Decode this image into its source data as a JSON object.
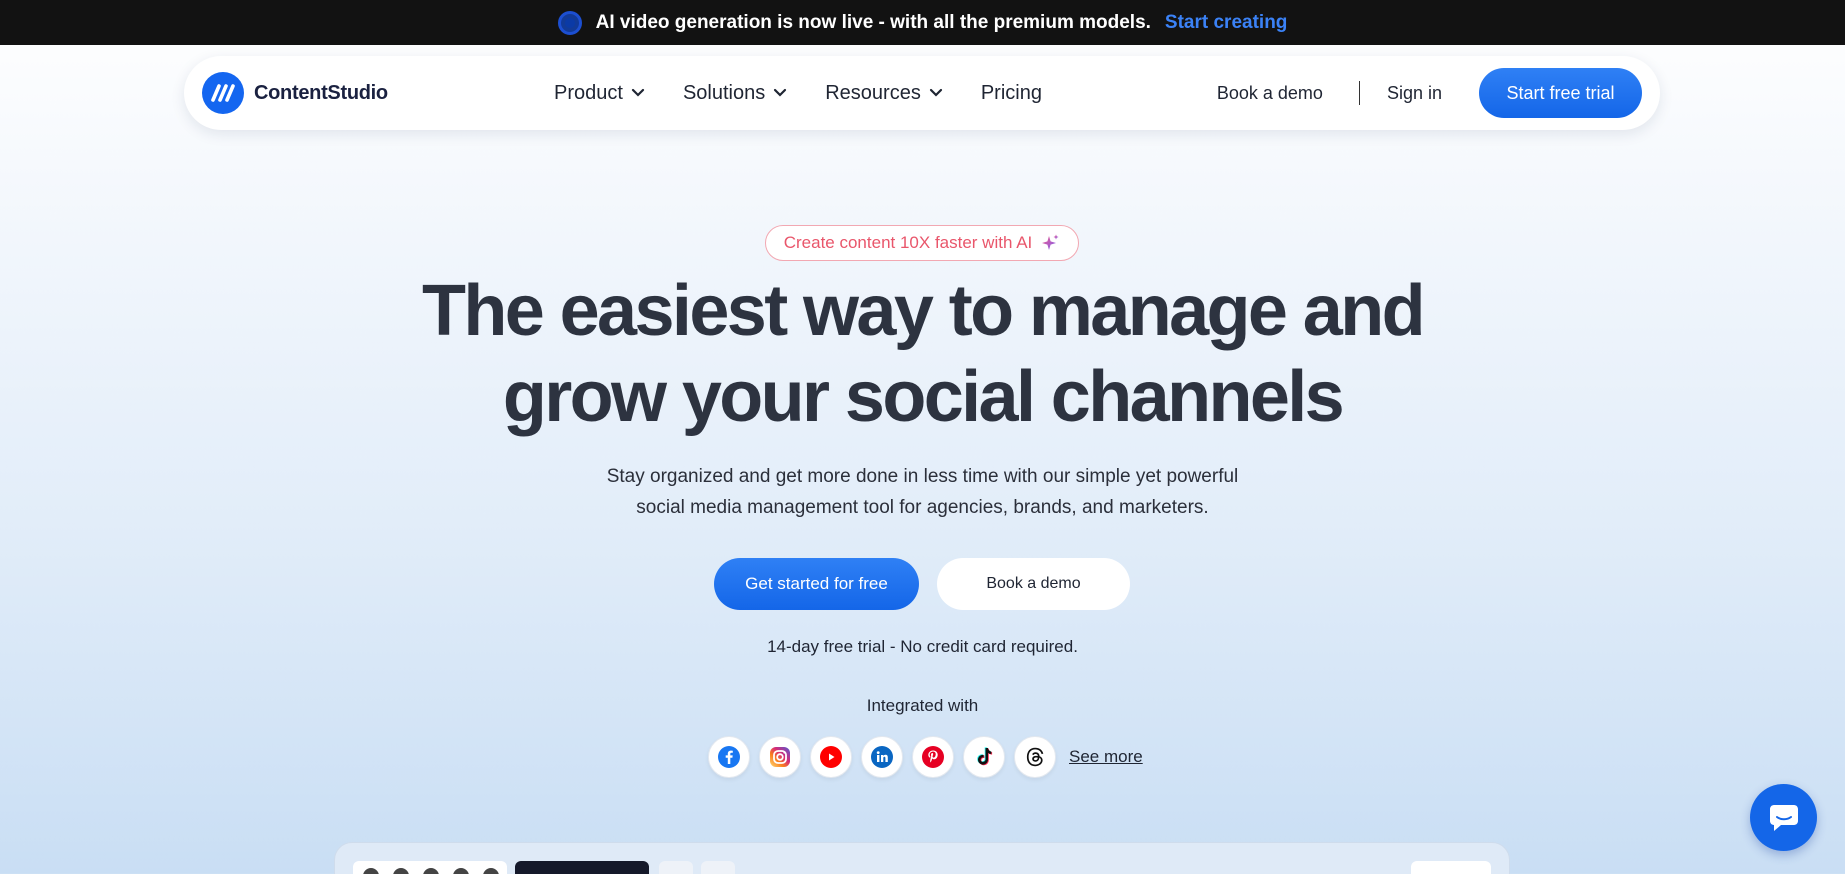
{
  "announcement": {
    "text": "AI video generation is now live - with all the premium models.",
    "cta": "Start creating"
  },
  "nav": {
    "brand": "ContentStudio",
    "links": [
      {
        "label": "Product",
        "dropdown": true
      },
      {
        "label": "Solutions",
        "dropdown": true
      },
      {
        "label": "Resources",
        "dropdown": true
      },
      {
        "label": "Pricing",
        "dropdown": false
      }
    ],
    "book_demo": "Book a demo",
    "sign_in": "Sign in",
    "start_trial": "Start free trial"
  },
  "hero": {
    "pill": "Create content 10X faster with AI",
    "title_line1": "The easiest way to manage and",
    "title_line2": "grow your social channels",
    "subtitle_line1": "Stay organized and get more done in less time with our simple yet powerful",
    "subtitle_line2": "social media management tool for agencies, brands, and marketers.",
    "primary_cta": "Get started for free",
    "secondary_cta": "Book a demo",
    "trial_note": "14-day free trial - No credit card required.",
    "integrated_label": "Integrated with",
    "see_more": "See more"
  },
  "integrations": [
    "facebook-icon",
    "instagram-icon",
    "youtube-icon",
    "linkedin-icon",
    "pinterest-icon",
    "tiktok-icon",
    "threads-icon"
  ],
  "colors": {
    "accent": "#1a73f0",
    "announcement_bg": "#121212",
    "pill_text": "#e9566b"
  }
}
